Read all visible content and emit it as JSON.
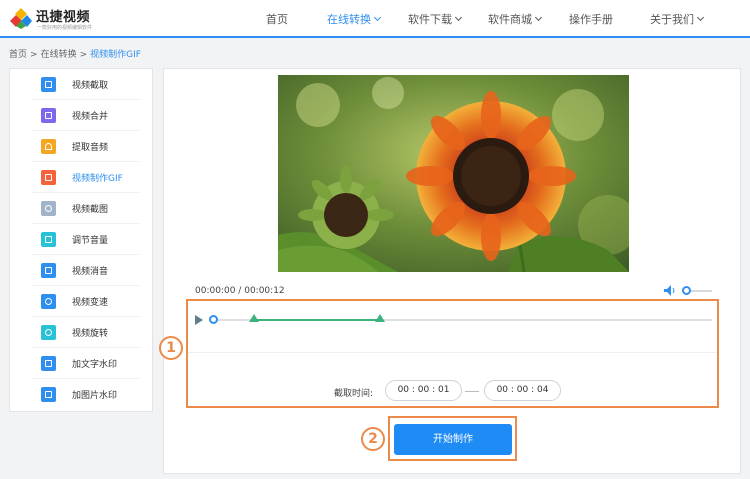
{
  "brand": {
    "name": "迅捷视频",
    "slogan": "一款好用的视频编辑软件"
  },
  "nav": [
    {
      "label": "首页",
      "active": false,
      "dropdown": false
    },
    {
      "label": "在线转换",
      "active": true,
      "dropdown": true
    },
    {
      "label": "软件下载",
      "active": false,
      "dropdown": true
    },
    {
      "label": "软件商城",
      "active": false,
      "dropdown": true
    },
    {
      "label": "操作手册",
      "active": false,
      "dropdown": false
    },
    {
      "label": "关于我们",
      "active": false,
      "dropdown": true
    }
  ],
  "breadcrumb": {
    "items": [
      "首页",
      "在线转换",
      "视频制作GIF"
    ],
    "separator": ">"
  },
  "sidebar": {
    "items": [
      {
        "label": "视频截取",
        "icon": "crop-icon",
        "color": "#2e8ff0"
      },
      {
        "label": "视频合并",
        "icon": "merge-icon",
        "color": "#7b68ee"
      },
      {
        "label": "提取音频",
        "icon": "headphones-icon",
        "color": "#f5a623"
      },
      {
        "label": "视频制作GIF",
        "icon": "gif-icon",
        "color": "#f5623b",
        "active": true
      },
      {
        "label": "视频截图",
        "icon": "scissors-icon",
        "color": "#9fb4c8"
      },
      {
        "label": "调节音量",
        "icon": "speaker-icon",
        "color": "#28c2d6"
      },
      {
        "label": "视频消音",
        "icon": "mute-video-icon",
        "color": "#2e8ff0"
      },
      {
        "label": "视频变速",
        "icon": "speed-icon",
        "color": "#2e8ff0"
      },
      {
        "label": "视频旋转",
        "icon": "rotate-icon",
        "color": "#28c2d6"
      },
      {
        "label": "加文字水印",
        "icon": "text-watermark-icon",
        "color": "#2e8ff0"
      },
      {
        "label": "加图片水印",
        "icon": "image-watermark-icon",
        "color": "#2e8ff0"
      }
    ]
  },
  "player": {
    "current_time": "00:00:00",
    "separator": "/",
    "duration": "00:00:12",
    "volume_level": 0.1
  },
  "timeline": {
    "range_start_fraction": 0.083,
    "range_end_fraction": 0.333
  },
  "cut": {
    "label": "截取时间:",
    "start": "00 : 00 : 01",
    "end": "00 : 00 : 04"
  },
  "markers": {
    "one": "1",
    "two": "2"
  },
  "actions": {
    "start_label": "开始制作"
  },
  "colors": {
    "accent": "#2e8ff0",
    "callout": "#ec8a4a",
    "range": "#3bb37e"
  }
}
